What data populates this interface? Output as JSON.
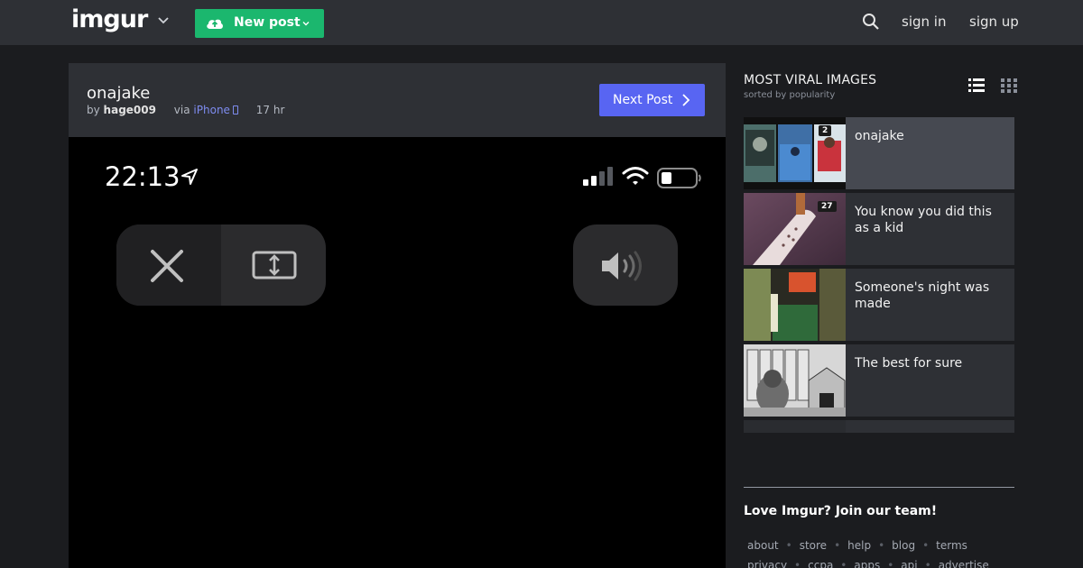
{
  "header": {
    "logo": "imgur",
    "new_post_label": "New post",
    "sign_in": "sign in",
    "sign_up": "sign up"
  },
  "post": {
    "title": "onajake",
    "by_prefix": "by",
    "author": "hage009",
    "via_prefix": "via",
    "platform": "iPhone",
    "age": "17 hr",
    "next_label": "Next Post",
    "screen": {
      "time": "22:13"
    }
  },
  "sidebar": {
    "heading": "MOST VIRAL IMAGES",
    "subheading": "sorted by popularity",
    "items": [
      {
        "title": "onajake",
        "count": "2",
        "active": true
      },
      {
        "title": "You know you did this as a kid",
        "count": "27"
      },
      {
        "title": "Someone's night was made"
      },
      {
        "title": "The best for sure"
      }
    ],
    "join": "Love Imgur? Join our team!",
    "footer_row1": [
      "about",
      "store",
      "help",
      "blog",
      "terms"
    ],
    "footer_row2": [
      "privacy",
      "ccpa",
      "apps",
      "api",
      "advertise"
    ]
  },
  "colors": {
    "brand_green": "#1bb76e",
    "next_button": "#5865f2",
    "topbar": "#2e3035",
    "background": "#1b1c1f"
  }
}
